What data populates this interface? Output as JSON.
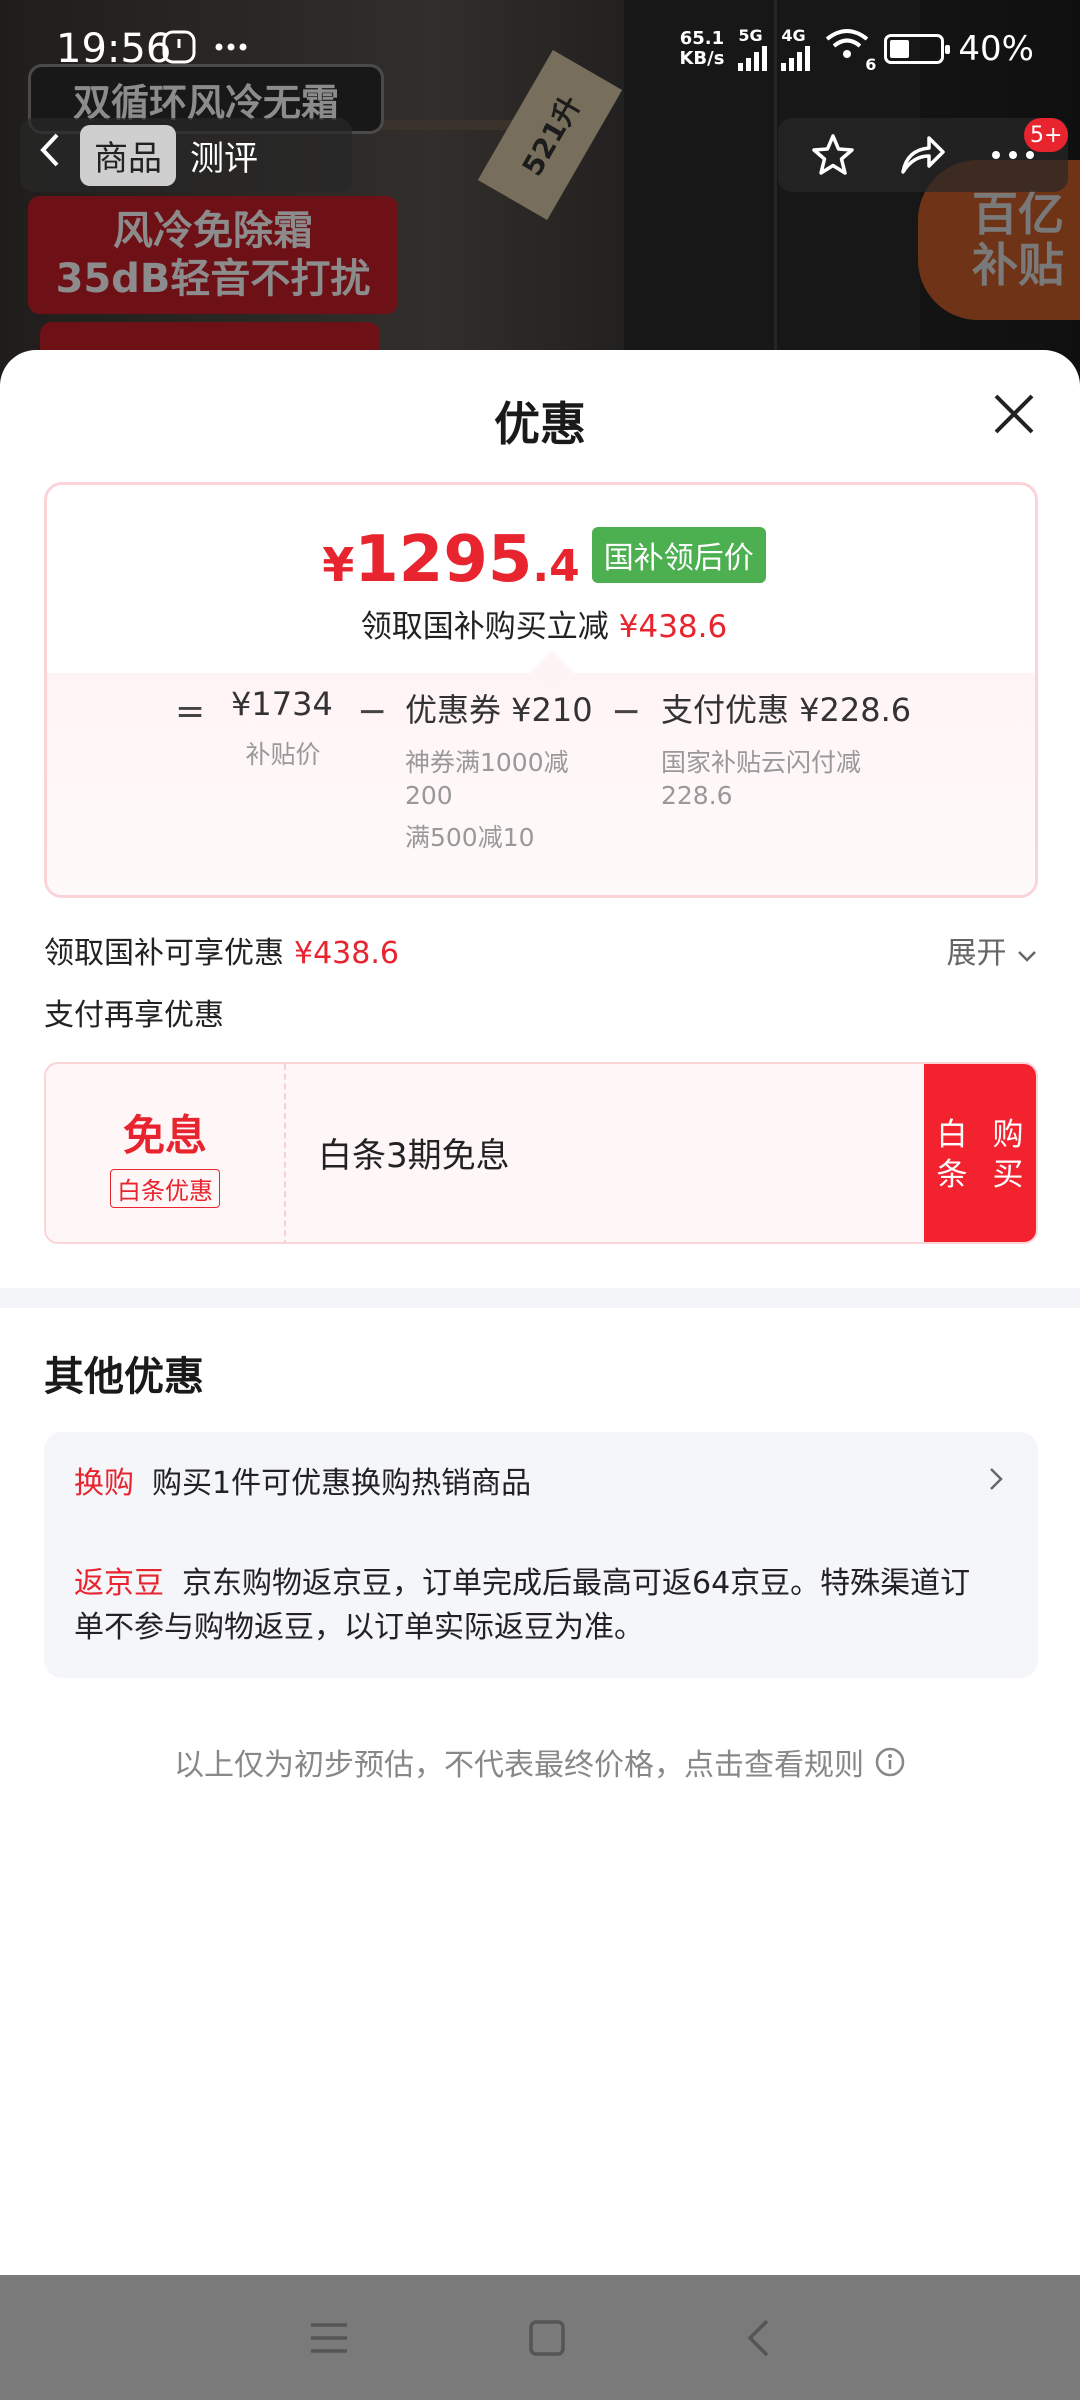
{
  "status_bar": {
    "time": "19:56",
    "net_speed_value": "65.1",
    "net_speed_unit": "KB/s",
    "sig1_label": "5G",
    "sig2_label": "4G",
    "wifi_label": "6",
    "battery": "40%",
    "battery_level": 0.4
  },
  "product": {
    "banner_1": "双循环风冷无霜",
    "banner_2_line1": "风冷免除霜",
    "banner_2_line2": "35dB轻音不打扰",
    "capacity": "521升",
    "subsidy_line1": "百亿",
    "subsidy_line2": "补贴"
  },
  "nav": {
    "back_icon": "chevron-left-icon",
    "tabs": [
      "商品",
      "测评"
    ],
    "notif_badge": "5+"
  },
  "sheet": {
    "title": "优惠",
    "price": {
      "currency": "¥",
      "integer": "1295",
      "decimal": ".4",
      "tag": "国补领后价",
      "sub_text": "领取国补购买立减",
      "sub_amount": "¥438.6"
    },
    "formula": {
      "eq": "=",
      "minus": "−",
      "col1_main": "¥1734",
      "col1_desc": "补贴价",
      "col2_main": "优惠券 ¥210",
      "col2_desc1": "神券满1000减200",
      "col2_desc2": "满500减10",
      "col3_main": "支付优惠 ¥228.6",
      "col3_desc": "国家补贴云闪付减228.6"
    },
    "savings_label": "领取国补可享优惠",
    "savings_amount": "¥438.6",
    "expand_label": "展开",
    "pay_label": "支付再享优惠",
    "coupon": {
      "big": "免息",
      "tag": "白条优惠",
      "text": "白条3期免息",
      "button_line1": "白条",
      "button_line2": "购买"
    },
    "other_title": "其他优惠",
    "other_items": [
      {
        "tag": "换购",
        "text": "购买1件可优惠换购热销商品"
      },
      {
        "tag": "返京豆",
        "text": "京东购物返京豆，订单完成后最高可返64京豆。特殊渠道订单不参与购物返豆，以订单实际返豆为准。"
      }
    ],
    "disclaimer": "以上仅为初步预估，不代表最终价格，点击查看规则"
  },
  "colors": {
    "accent_red": "#e8242e",
    "tag_green": "#4caf50",
    "card_border": "#fbd4d8"
  }
}
